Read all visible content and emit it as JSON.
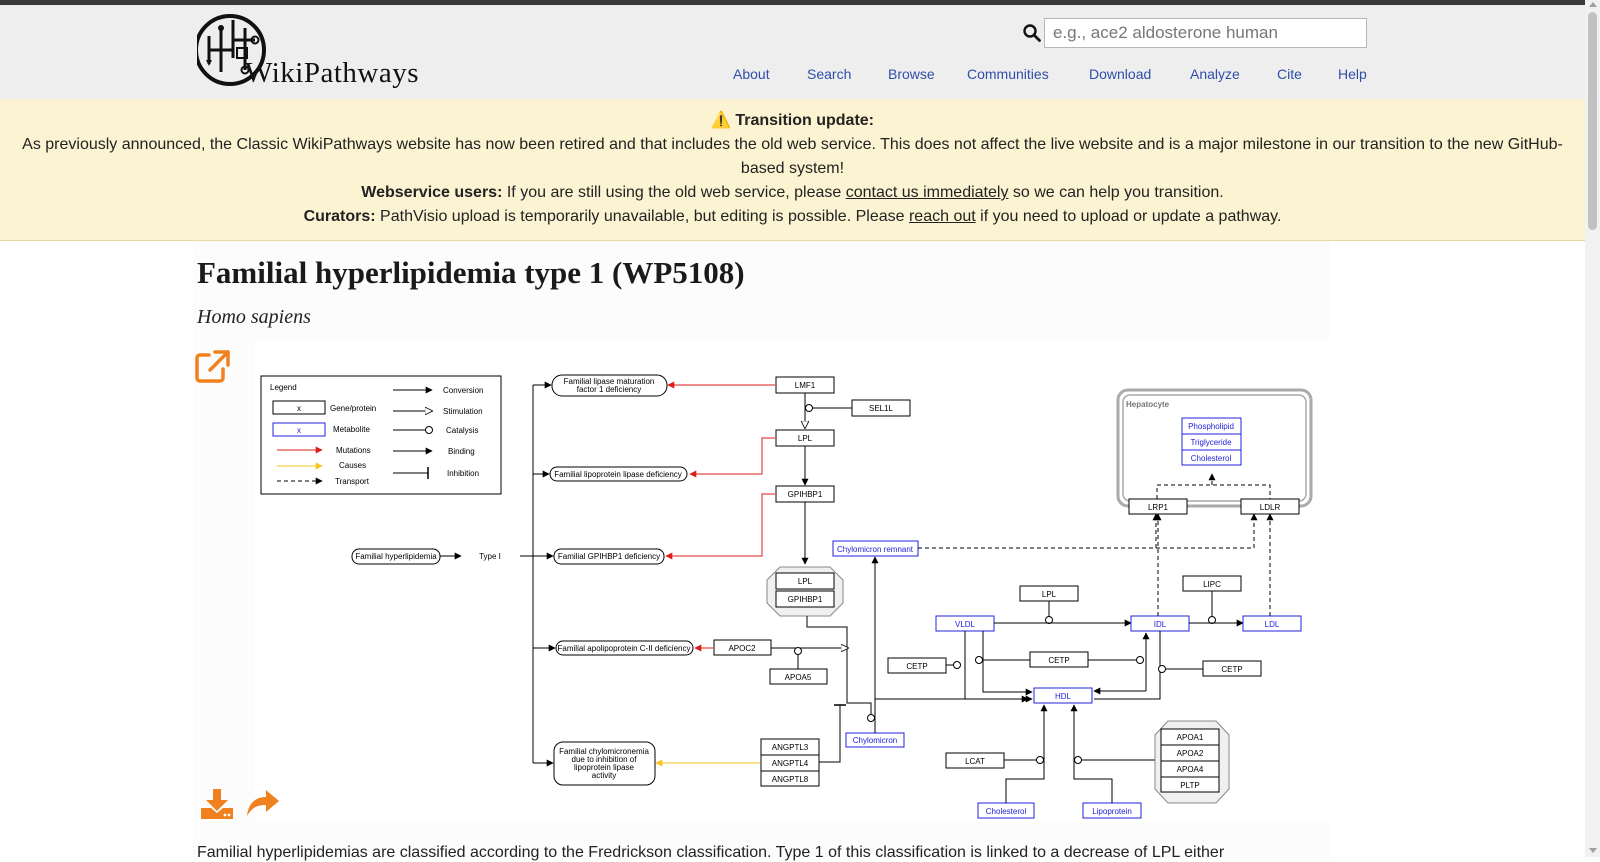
{
  "site": {
    "logo_text": "WikiPathways",
    "search_placeholder": "e.g., ace2 aldosterone human",
    "search_icon": "magnifier-icon"
  },
  "nav": [
    "About",
    "Search",
    "Browse",
    "Communities",
    "Download",
    "Analyze",
    "Cite",
    "Help"
  ],
  "banner": {
    "icon": "warning-icon",
    "title": "⚠️ Transition update:",
    "line1": "As previously announced, the Classic WikiPathways website has now been retired and that includes the old web service. This does not affect the live website and is a major milestone in our transition to the new GitHub-based system!",
    "ws_label": "Webservice users:",
    "ws_text_before": "If you are still using the old web service, please",
    "ws_link": "contact us immediately",
    "ws_text_after": "so we can help you transition.",
    "cur_label": "Curators:",
    "cur_text_before": "PathVisio upload is temporarily unavailable, but editing is possible. Please",
    "cur_link": "reach out",
    "cur_text_after": "if you need to upload or update a pathway."
  },
  "page": {
    "title": "Familial hyperlipidemia type 1 (WP5108)",
    "species": "Homo sapiens",
    "description": "Familial hyperlipidemias are classified according to the Fredrickson classification. Type 1 of this classification is linked to a decrease of LPL either"
  },
  "actions": {
    "open_icon": "external-link-icon",
    "download_icon": "download-icon",
    "share_icon": "share-icon"
  },
  "colors": {
    "accent": "#f0811e",
    "metabolite": "#2222dd",
    "mutation": "#e01b1b",
    "cause": "#f5c518",
    "banner": "#fcf3d2"
  },
  "diagram": {
    "legend": {
      "title": "Legend",
      "sample": "x",
      "gene": "Gene/protein",
      "metabolite": "Metabolite",
      "mutations": "Mutations",
      "causes": "Causes",
      "transport": "Transport",
      "conversion": "Conversion",
      "stimulation": "Stimulation",
      "catalysis": "Catalysis",
      "binding": "Binding",
      "inhibition": "Inhibition"
    },
    "diseases": {
      "hyperlipidemia": "Familial hyperlipidemia",
      "type1": "Type I",
      "lmf1_def_1": "Familial lipase maturation",
      "lmf1_def_2": "factor 1 deficiency",
      "lpl_def": "Familial lipoprotein lipase deficiency",
      "gpihbp1_def": "Familial GPIHBP1 deficiency",
      "apoc2_def": "Familial apolipoprotein C-II deficiency",
      "chylo_1": "Familial chylomicronemia",
      "chylo_2": "due to inhibition of",
      "chylo_3": "lipoprotein lipase",
      "chylo_4": "activity"
    },
    "genes": {
      "lmf1": "LMF1",
      "sel1l": "SEL1L",
      "lpl": "LPL",
      "gpihbp1": "GPIHBP1",
      "apoc2": "APOC2",
      "apoa5": "APOA5",
      "angptl3": "ANGPTL3",
      "angptl4": "ANGPTL4",
      "angptl8": "ANGPTL8",
      "cetp": "CETP",
      "lcat": "LCAT",
      "lipc": "LIPC",
      "lrp1": "LRP1",
      "ldlr": "LDLR",
      "apoa1": "APOA1",
      "apoa2": "APOA2",
      "apoa4": "APOA4",
      "pltp": "PLTP"
    },
    "metabolites": {
      "chylo_remnant": "Chylomicron remnant",
      "chylomicron": "Chylomicron",
      "vldl": "VLDL",
      "idl": "IDL",
      "ldl": "LDL",
      "hdl": "HDL",
      "cholesterol": "Cholesterol",
      "lipoprotein": "Lipoprotein",
      "phospholipid": "Phospholipid",
      "triglyceride": "Triglyceride"
    },
    "hepatocyte": "Hepatocyte"
  }
}
